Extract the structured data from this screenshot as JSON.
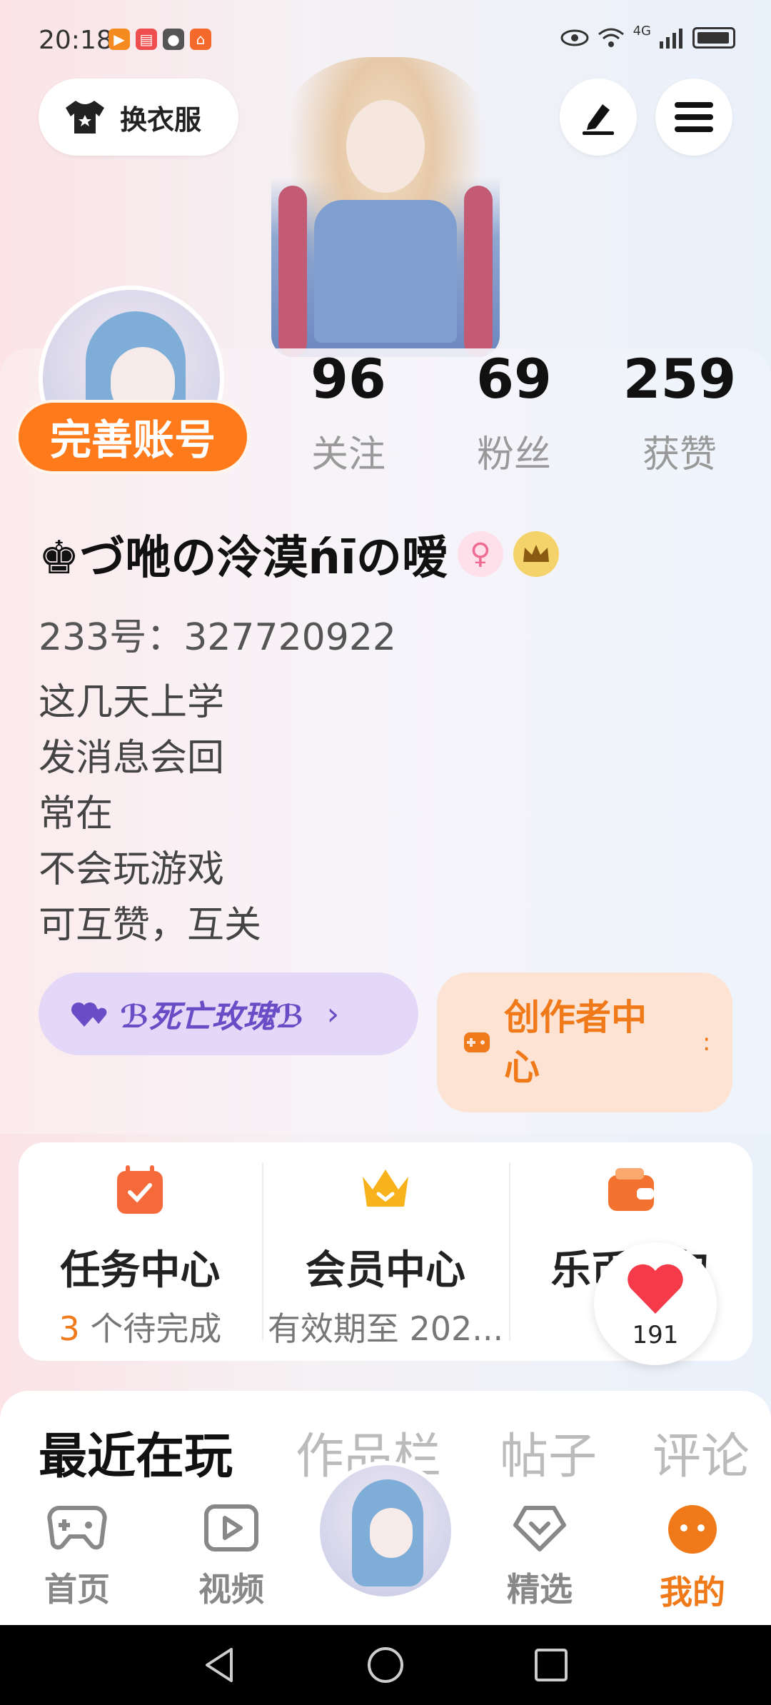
{
  "status_bar": {
    "time": "20:18",
    "network": "4G"
  },
  "header": {
    "change_clothes_label": "换衣服"
  },
  "profile": {
    "complete_account_label": "完善账号",
    "username": "♚づ咃の泠漠ńīの嗳",
    "uid_text": "233号：327720922",
    "gender_symbol": "♀",
    "bio_lines": [
      "这几天上学",
      "发消息会回",
      "常在",
      "不会玩游戏",
      "可互赞，互关"
    ],
    "stats": [
      {
        "num": "96",
        "label": "关注"
      },
      {
        "num": "69",
        "label": "粉丝"
      },
      {
        "num": "259",
        "label": "获赞"
      }
    ],
    "guild_label": "ℬ死亡玫瑰ℬ",
    "guild_chevron": "›",
    "creator_label": "创作者中心",
    "creator_dots": ":"
  },
  "services": [
    {
      "title": "任务中心",
      "highlight": "3",
      "sub": " 个待完成",
      "icon": "calendar-check-icon",
      "color": "#f56a3b"
    },
    {
      "title": "会员中心",
      "highlight": "",
      "sub": "有效期至 202...",
      "icon": "crown-icon",
      "color": "#f7b21c"
    },
    {
      "title": "乐币钱包",
      "highlight": "0",
      "sub": "",
      "icon": "wallet-icon",
      "color": "#f4722f"
    }
  ],
  "floating_like": {
    "count": "191"
  },
  "tabs": [
    {
      "label": "最近在玩",
      "active": true
    },
    {
      "label": "作品栏",
      "active": false
    },
    {
      "label": "帖子",
      "active": false
    },
    {
      "label": "评论",
      "active": false
    }
  ],
  "bottom_nav": [
    {
      "label": "首页",
      "icon": "gamepad-icon"
    },
    {
      "label": "视频",
      "icon": "video-play-icon"
    },
    {
      "label": "精选",
      "icon": "heart-diamond-icon"
    },
    {
      "label": "我的",
      "icon": "smile-face-icon"
    }
  ],
  "colors": {
    "accent": "#ff7a1a",
    "guild_purple": "#6a4dc6",
    "creator_bg": "#fde3d3"
  }
}
